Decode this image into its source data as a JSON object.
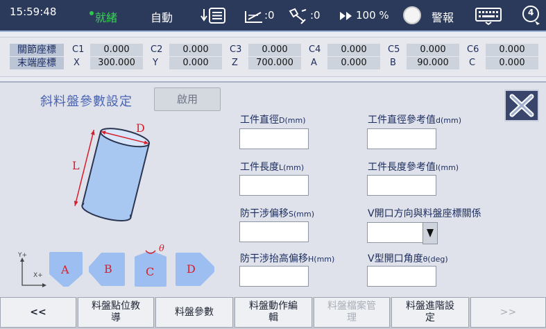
{
  "status_bar": {
    "time": "15:59:48",
    "ready": "就緒",
    "mode": "自動",
    "counter_a": ":0",
    "counter_b": ":0",
    "speed": "100 %",
    "alarm": "警報",
    "badge_number": "4"
  },
  "coords": {
    "row1_label": "關節座標",
    "row2_label": "末端座標",
    "row1": [
      {
        "axis": "C1",
        "value": "0.000"
      },
      {
        "axis": "C2",
        "value": "0.000"
      },
      {
        "axis": "C3",
        "value": "0.000"
      },
      {
        "axis": "C4",
        "value": "0.000"
      },
      {
        "axis": "C5",
        "value": "0.000"
      },
      {
        "axis": "C6",
        "value": "0.000"
      }
    ],
    "row2": [
      {
        "axis": "X",
        "value": "300.000"
      },
      {
        "axis": "Y",
        "value": "0.000"
      },
      {
        "axis": "Z",
        "value": "700.000"
      },
      {
        "axis": "A",
        "value": "0.000"
      },
      {
        "axis": "B",
        "value": "90.000"
      },
      {
        "axis": "C",
        "value": "0.000"
      }
    ]
  },
  "panel": {
    "title": "斜料盤參數設定",
    "enable_label": "啟用",
    "diagram": {
      "d_label": "D",
      "l_label": "L",
      "theta": "θ",
      "y_axis": "Y+",
      "x_axis": "X+"
    },
    "shapes": [
      "A",
      "B",
      "C",
      "D"
    ],
    "fields": {
      "diameter": {
        "label": "工件直徑",
        "unit": "D(mm)",
        "value": ""
      },
      "diameter_ref": {
        "label": "工件直徑參考值",
        "unit": "d(mm)",
        "value": ""
      },
      "length": {
        "label": "工件長度",
        "unit": "L(mm)",
        "value": ""
      },
      "length_ref": {
        "label": "工件長度參考值",
        "unit": "l(mm)",
        "value": ""
      },
      "offset": {
        "label": "防干涉偏移",
        "unit": "S(mm)",
        "value": ""
      },
      "v_direction": {
        "label": "V開口方向與料盤座標關係",
        "unit": "",
        "value": ""
      },
      "lift_offset": {
        "label": "防干涉抬高偏移",
        "unit": "H(mm)",
        "value": ""
      },
      "v_angle": {
        "label": "V型開口角度",
        "unit": "θ(deg)",
        "value": ""
      }
    }
  },
  "softkeys": {
    "prev": "<<",
    "teach": "料盤點位教導",
    "params": "料盤參數",
    "motion_edit": "料盤動作編輯",
    "file_mgmt": "料盤檔案管理",
    "advanced": "料盤進階設定",
    "next": ">>"
  },
  "colors": {
    "topbar_bg": "#2b3a5a",
    "ready_green": "#35d352",
    "title_blue": "#4a64b4",
    "diagram_red": "#d81e2a",
    "shape_fill": "#9cbef0"
  }
}
